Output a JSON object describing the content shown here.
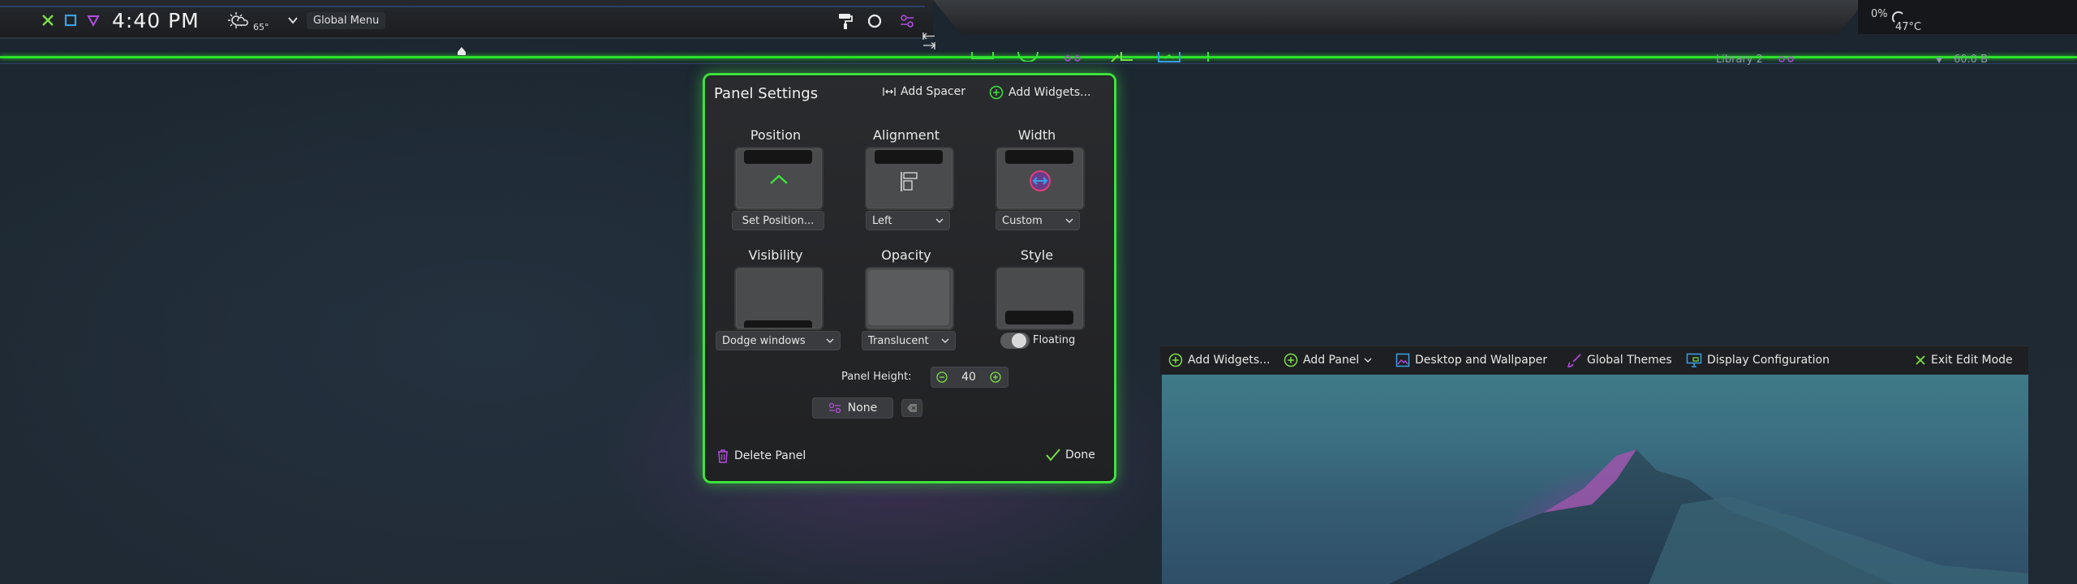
{
  "topbar": {
    "clock": "4:40 PM",
    "weather_temp": "65°",
    "global_menu_label": "Global Menu",
    "cpu_percent": "0%",
    "cpu_temp": "47°C",
    "library_label": "Library 2",
    "storage_label": "60.0 B"
  },
  "panel_settings": {
    "title": "Panel Settings",
    "add_spacer": "Add Spacer",
    "add_widgets": "Add Widgets...",
    "position": {
      "label": "Position",
      "button": "Set Position..."
    },
    "alignment": {
      "label": "Alignment",
      "value": "Left"
    },
    "width": {
      "label": "Width",
      "value": "Custom"
    },
    "visibility": {
      "label": "Visibility",
      "value": "Dodge windows"
    },
    "opacity": {
      "label": "Opacity",
      "value": "Translucent"
    },
    "style": {
      "label": "Style",
      "toggle_label": "Floating"
    },
    "panel_height_label": "Panel Height:",
    "panel_height_value": "40",
    "shortcut_value": "None",
    "delete_panel": "Delete Panel",
    "done": "Done"
  },
  "edit_toolbar": {
    "add_widgets": "Add Widgets...",
    "add_panel": "Add Panel",
    "desktop_wallpaper": "Desktop and Wallpaper",
    "global_themes": "Global Themes",
    "display_configuration": "Display Configuration",
    "exit_edit_mode": "Exit Edit Mode"
  },
  "colors": {
    "accent_green": "#3de23d",
    "accent_purple": "#b34ce0",
    "accent_blue": "#3aa0e6",
    "dialog_bg": "#242527"
  }
}
